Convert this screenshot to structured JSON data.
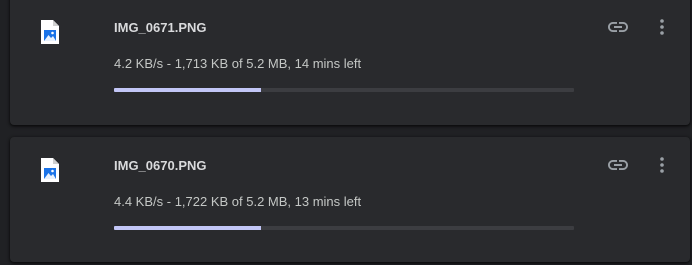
{
  "downloads": [
    {
      "file_name": "IMG_0671.PNG",
      "status": "4.2 KB/s - 1,713 KB of 5.2 MB, 14 mins left",
      "progress_percent": 32,
      "icon": "image-file-icon",
      "actions": [
        "copy-link-icon",
        "more-vert-icon"
      ]
    },
    {
      "file_name": "IMG_0670.PNG",
      "status": "4.4 KB/s - 1,722 KB of 5.2 MB, 13 mins left",
      "progress_percent": 32,
      "icon": "image-file-icon",
      "actions": [
        "copy-link-icon",
        "more-vert-icon"
      ]
    }
  ],
  "colors": {
    "page_background": "#202124",
    "card_background": "#292a2d",
    "progress_fill": "#c2c6f6",
    "progress_track": "#3c3d41",
    "file_icon_accent": "#1a73e8"
  }
}
